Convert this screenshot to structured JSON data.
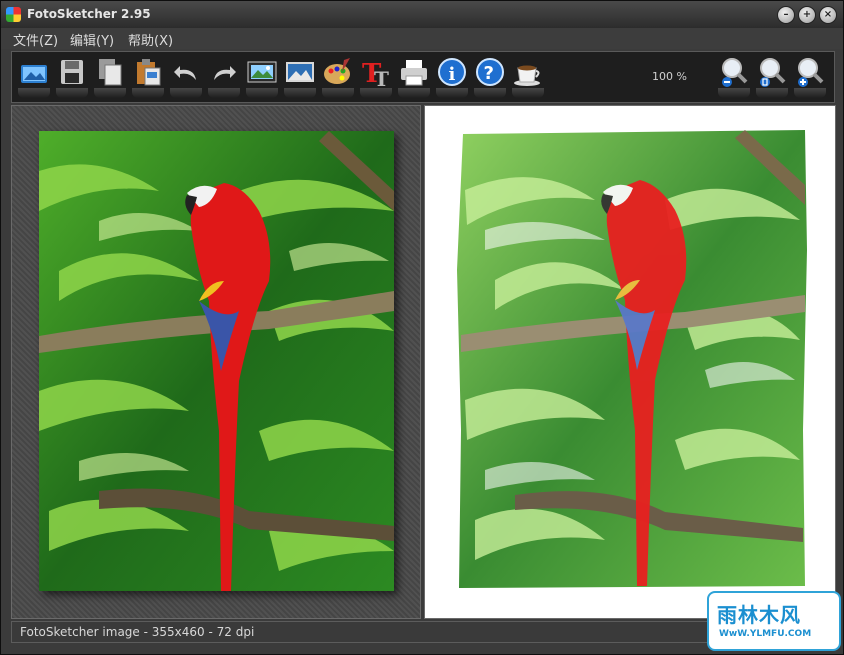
{
  "window": {
    "title": "FotoSketcher 2.95",
    "controls": [
      "minimize",
      "maximize",
      "close"
    ]
  },
  "menu": {
    "items": [
      {
        "label": "文件(Z)"
      },
      {
        "label": "编辑(Y)"
      },
      {
        "label": "帮助(X)"
      }
    ]
  },
  "toolbar": {
    "buttons": [
      {
        "icon": "open-image-icon"
      },
      {
        "icon": "save-icon"
      },
      {
        "icon": "copy-icon"
      },
      {
        "icon": "paste-icon"
      },
      {
        "icon": "undo-icon"
      },
      {
        "icon": "redo-icon"
      },
      {
        "icon": "process-image-icon"
      },
      {
        "icon": "landscape-image-icon"
      },
      {
        "icon": "palette-icon"
      },
      {
        "icon": "text-icon"
      },
      {
        "icon": "print-icon"
      },
      {
        "icon": "info-icon"
      },
      {
        "icon": "help-icon"
      },
      {
        "icon": "coffee-icon"
      }
    ],
    "zoom_label": "100 %",
    "zoom_buttons": [
      {
        "icon": "zoom-out-icon"
      },
      {
        "icon": "zoom-fit-icon"
      },
      {
        "icon": "zoom-in-icon"
      }
    ]
  },
  "status": {
    "text": "FotoSketcher image - 355x460 - 72 dpi"
  },
  "watermark": {
    "line1": "雨林木风",
    "line2": "WwW.YLMFU.COM"
  },
  "colors": {
    "parrot_red": "#e01818",
    "foliage_green": "#3aa02a",
    "accent_blue": "#2fa3d8"
  }
}
